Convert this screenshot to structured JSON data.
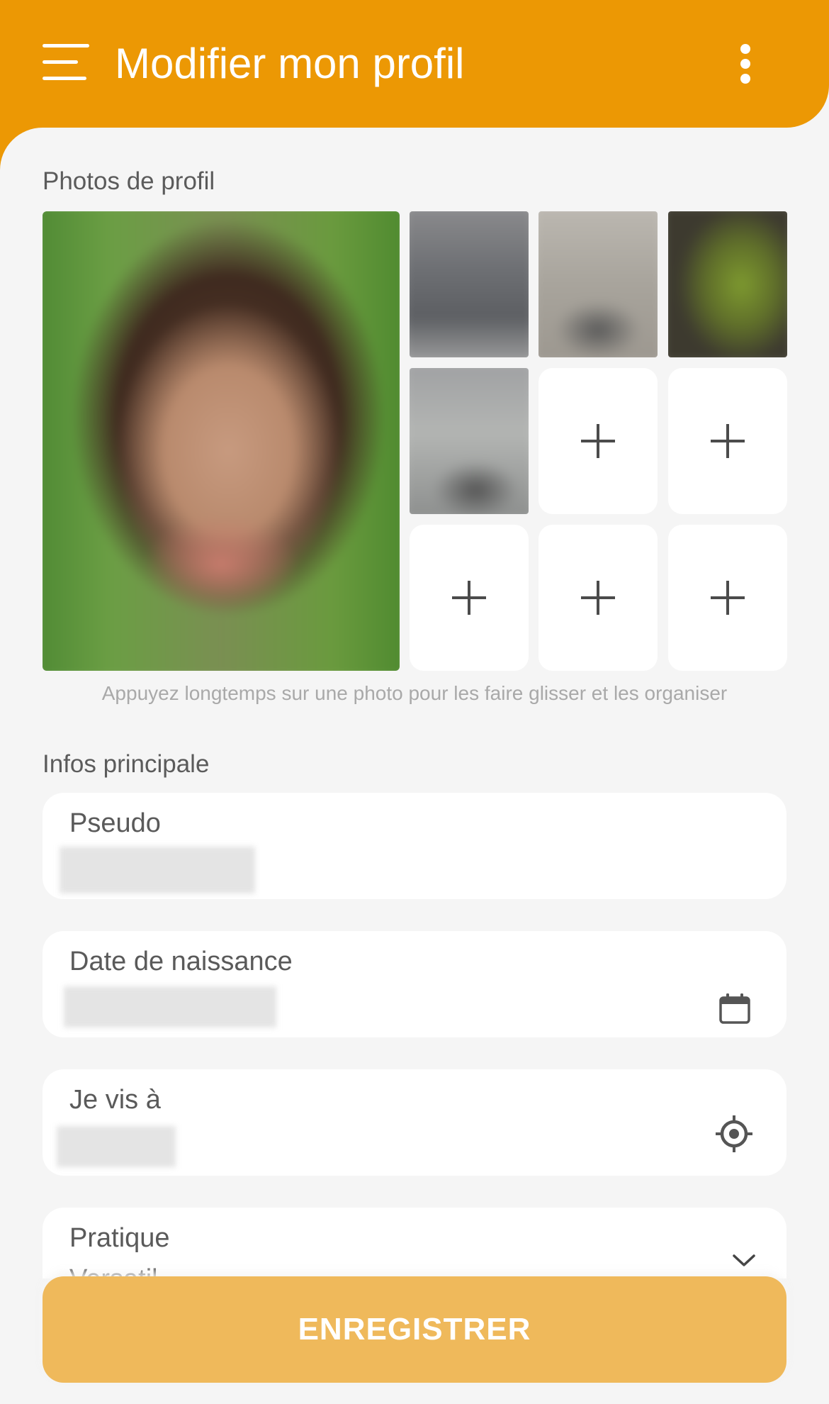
{
  "header": {
    "title": "Modifier mon profil",
    "menu_icon": "hamburger-menu-icon",
    "more_icon": "more-vertical-icon",
    "background_color": "#ec9804"
  },
  "photos": {
    "section_label": "Photos de profil",
    "filled_count": 5,
    "empty_slots": 5,
    "add_icon": "plus-icon",
    "hint": "Appuyez longtemps sur une photo pour les faire glisser et les organiser"
  },
  "main_info": {
    "section_label": "Infos principale",
    "fields": [
      {
        "label": "Pseudo",
        "value": "",
        "icon": ""
      },
      {
        "label": "Date de naissance",
        "value": "",
        "icon": "calendar-icon"
      },
      {
        "label": "Je vis à",
        "value": "",
        "icon": "locate-target-icon"
      },
      {
        "label": "Pratique",
        "value": "Versatil",
        "icon": "chevron-down-icon"
      }
    ]
  },
  "actions": {
    "save_label": "ENREGISTRER",
    "save_color": "#efb95b"
  }
}
